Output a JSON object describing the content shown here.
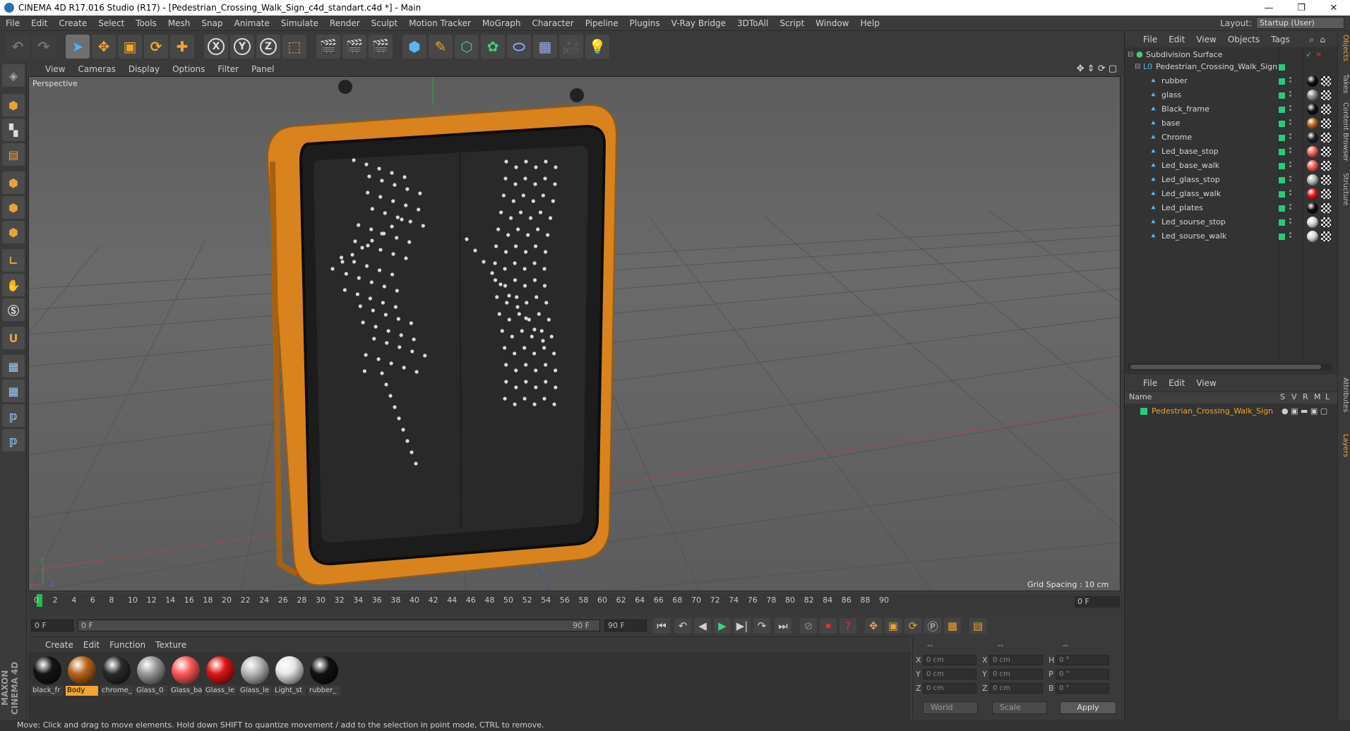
{
  "title_bar": {
    "title": "CINEMA 4D R17.016 Studio (R17) - [Pedestrian_Crossing_Walk_Sign_c4d_standart.c4d *] - Main",
    "minimize": "—",
    "restore": "❐",
    "close": "✕"
  },
  "menu": {
    "items": [
      "File",
      "Edit",
      "Create",
      "Select",
      "Tools",
      "Mesh",
      "Snap",
      "Animate",
      "Simulate",
      "Render",
      "Sculpt",
      "Motion Tracker",
      "MoGraph",
      "Character",
      "Pipeline",
      "Plugins",
      "V-Ray Bridge",
      "3DToAll",
      "Script",
      "Window",
      "Help"
    ],
    "layout_label": "Layout:",
    "layout_value": "Startup (User)"
  },
  "toolbar": {
    "x_axis": "X",
    "y_axis": "Y",
    "z_axis": "Z"
  },
  "viewport": {
    "menu": [
      "View",
      "Cameras",
      "Display",
      "Options",
      "Filter",
      "Panel"
    ],
    "label": "Perspective",
    "grid_spacing": "Grid Spacing : 10 cm",
    "axis_y": "y",
    "axis_x": "x",
    "axis_z": "z"
  },
  "timeline": {
    "ticks": [
      "0",
      "2",
      "4",
      "6",
      "8",
      "10",
      "12",
      "14",
      "16",
      "18",
      "20",
      "22",
      "24",
      "26",
      "28",
      "30",
      "32",
      "34",
      "36",
      "38",
      "40",
      "42",
      "44",
      "46",
      "48",
      "50",
      "52",
      "54",
      "56",
      "58",
      "60",
      "62",
      "64",
      "66",
      "68",
      "70",
      "72",
      "74",
      "76",
      "78",
      "80",
      "82",
      "84",
      "86",
      "88",
      "90"
    ],
    "current_frame": "0 F",
    "start_field": "0 F",
    "range_start": "0 F",
    "range_end": "90 F",
    "end_field": "90 F"
  },
  "materials": {
    "menu": [
      "Create",
      "Edit",
      "Function",
      "Texture"
    ],
    "items": [
      {
        "name": "black_fr",
        "color": "#151515",
        "selected": false
      },
      {
        "name": "Body",
        "color": "#b8661a",
        "selected": true
      },
      {
        "name": "chrome_",
        "color": "#2a2a2a",
        "selected": false
      },
      {
        "name": "Glass_0",
        "color": "#9a9a9a",
        "selected": false
      },
      {
        "name": "Glass_ba",
        "color": "#ff5a5a",
        "selected": false
      },
      {
        "name": "Glass_le",
        "color": "#e01515",
        "selected": false
      },
      {
        "name": "Glass_le",
        "color": "#b8b8b8",
        "selected": false
      },
      {
        "name": "Light_st",
        "color": "#e6e6e6",
        "selected": false
      },
      {
        "name": "rubber_",
        "color": "#111111",
        "selected": false
      }
    ]
  },
  "coordinates": {
    "header": [
      "--",
      "--",
      "--"
    ],
    "rows": [
      {
        "l1": "X",
        "v1": "0 cm",
        "l2": "X",
        "v2": "0 cm",
        "l3": "H",
        "v3": "0 °"
      },
      {
        "l1": "Y",
        "v1": "0 cm",
        "l2": "Y",
        "v2": "0 cm",
        "l3": "P",
        "v3": "0 °"
      },
      {
        "l1": "Z",
        "v1": "0 cm",
        "l2": "Z",
        "v2": "0 cm",
        "l3": "B",
        "v3": "0 °"
      }
    ],
    "world": "World",
    "scale": "Scale",
    "apply": "Apply"
  },
  "objects_panel": {
    "menu": [
      "File",
      "Edit",
      "View",
      "Objects",
      "Tags"
    ],
    "root": "Subdivision Surface",
    "group": "Pedestrian_Crossing_Walk_Sign",
    "children": [
      {
        "name": "rubber",
        "mat": "#0d0d0d"
      },
      {
        "name": "glass",
        "mat": "#8a8a8a"
      },
      {
        "name": "Black_frame",
        "mat": "#111111"
      },
      {
        "name": "base",
        "mat": "#b8661a"
      },
      {
        "name": "Chrome",
        "mat": "#1e1e1e"
      },
      {
        "name": "Led_base_stop",
        "mat": "#ff5a5a"
      },
      {
        "name": "Led_base_walk",
        "mat": "#ff5a5a"
      },
      {
        "name": "Led_glass_stop",
        "mat": "#b8b8b8"
      },
      {
        "name": "Led_glass_walk",
        "mat": "#e01515"
      },
      {
        "name": "Led_plates",
        "mat": "#0d0d0d"
      },
      {
        "name": "Led_sourse_stop",
        "mat": "#d8d8d8"
      },
      {
        "name": "Led_sourse_walk",
        "mat": "#d8d8d8"
      }
    ]
  },
  "layers_panel": {
    "menu": [
      "File",
      "Edit",
      "View"
    ],
    "columns": [
      "Name",
      "S",
      "V",
      "R",
      "M",
      "L"
    ],
    "row": "Pedestrian_Crossing_Walk_Sign"
  },
  "side_tabs": [
    "Objects",
    "Takes",
    "Content Browser",
    "Structure",
    "Attributes",
    "Layers"
  ],
  "status": "Move: Click and drag to move elements. Hold down SHIFT to quantize movement / add to the selection in point mode, CTRL to remove.",
  "maxon_logo": "MAXON CINEMA 4D",
  "colors": {
    "accent": "#f0a431",
    "sign_body": "#d9831f",
    "active_green": "#1fd07a"
  }
}
